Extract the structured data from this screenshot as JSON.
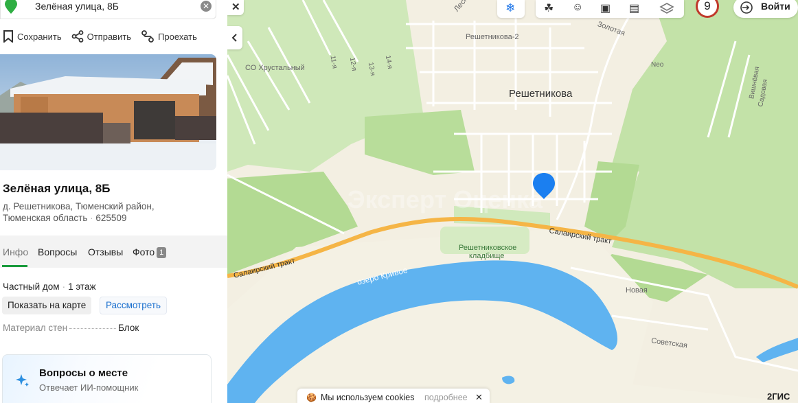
{
  "search": {
    "query": "Зелёная улица, 8Б"
  },
  "actions": [
    {
      "label": "Сохранить",
      "icon": "bookmark-icon"
    },
    {
      "label": "Отправить",
      "icon": "share-icon"
    },
    {
      "label": "Проехать",
      "icon": "route-icon"
    }
  ],
  "place": {
    "title": "Зелёная улица, 8Б",
    "address_line1": "д. Решетникова, Тюменский район,",
    "address_line2": "Тюменская область",
    "postcode": "625509"
  },
  "tabs": [
    {
      "label": "Инфо",
      "active": true
    },
    {
      "label": "Вопросы"
    },
    {
      "label": "Отзывы"
    },
    {
      "label": "Фото",
      "count": "1"
    }
  ],
  "info": {
    "type": "Частный дом",
    "floors": "1 этаж",
    "show_on_map": "Показать на карте",
    "view": "Рассмотреть",
    "material_label": "Материал стен",
    "material_value": "Блок"
  },
  "ai_card": {
    "title": "Вопросы о месте",
    "subtitle": "Отвечает ИИ-помощник"
  },
  "map": {
    "labels": {
      "village": "Решетникова",
      "village2": "Решетникова-2",
      "so": "СО Хрустальный",
      "zolotaya": "Золотая",
      "lesnaya": "Лесн",
      "neo": "Neo",
      "vishnevaya": "Вишнёвая",
      "sadovaya": "Садовая",
      "road1": "Салаирский тракт",
      "road2": "Салаирский тракт",
      "lake": "озеро Кривое",
      "cemetery1": "Решетниковское",
      "cemetery2": "кладбище",
      "novaya": "Новая",
      "sovetskaya": "Советская",
      "s11": "11-я",
      "s12": "12-я",
      "s13": "13-я",
      "s14": "14-я",
      "watermark": "Эксперт Оценка"
    },
    "traffic_score": "9",
    "login": "Войти",
    "brand": "2ГИС",
    "cookie_text": "Мы используем cookies",
    "cookie_more": "подробнее"
  },
  "colors": {
    "green": "#1a9b3c",
    "road": "#f5b546",
    "water": "#5fb3f0",
    "forest": "#c9e6b1",
    "pin": "#1b7ff0"
  }
}
